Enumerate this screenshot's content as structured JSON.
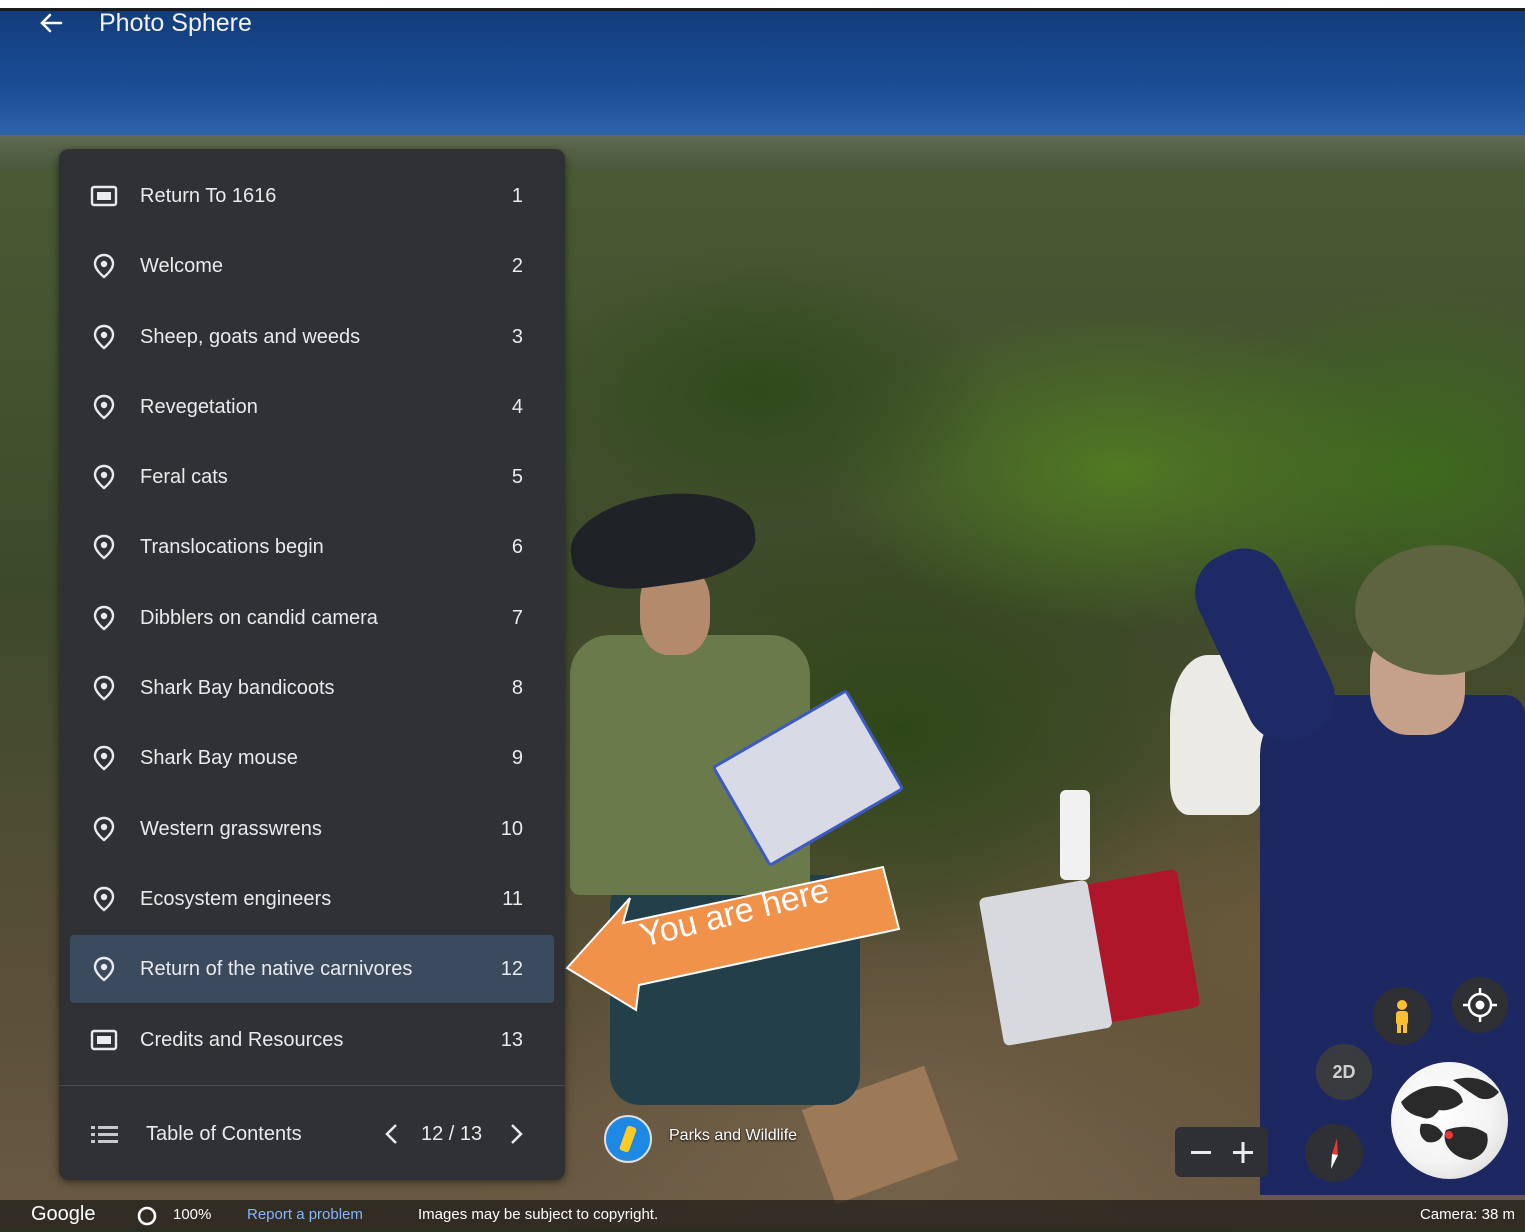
{
  "header": {
    "title": "Photo Sphere",
    "back_icon": "arrow-left-icon"
  },
  "tour": {
    "items": [
      {
        "icon": "slide-icon",
        "label": "Return To 1616",
        "number": "1",
        "active": false
      },
      {
        "icon": "place-icon",
        "label": "Welcome",
        "number": "2",
        "active": false
      },
      {
        "icon": "place-icon",
        "label": "Sheep, goats and weeds",
        "number": "3",
        "active": false
      },
      {
        "icon": "place-icon",
        "label": "Revegetation",
        "number": "4",
        "active": false
      },
      {
        "icon": "place-icon",
        "label": "Feral cats",
        "number": "5",
        "active": false
      },
      {
        "icon": "place-icon",
        "label": "Translocations begin",
        "number": "6",
        "active": false
      },
      {
        "icon": "place-icon",
        "label": "Dibblers on candid camera",
        "number": "7",
        "active": false
      },
      {
        "icon": "place-icon",
        "label": "Shark Bay bandicoots",
        "number": "8",
        "active": false
      },
      {
        "icon": "place-icon",
        "label": "Shark Bay mouse",
        "number": "9",
        "active": false
      },
      {
        "icon": "place-icon",
        "label": "Western grasswrens",
        "number": "10",
        "active": false
      },
      {
        "icon": "place-icon",
        "label": "Ecosystem engineers",
        "number": "11",
        "active": false
      },
      {
        "icon": "place-icon",
        "label": "Return of the native carnivores",
        "number": "12",
        "active": true
      },
      {
        "icon": "slide-icon",
        "label": "Credits and Resources",
        "number": "13",
        "active": false
      }
    ],
    "footer": {
      "label": "Table of Contents",
      "counter": "12 / 13"
    }
  },
  "callout": {
    "text": "You are here",
    "color": "#f0924a"
  },
  "attribution": {
    "label": "Parks and Wildlife"
  },
  "controls": {
    "btn_2d": "2D"
  },
  "bottom": {
    "brand": "Google",
    "percent": "100%",
    "report": "Report a problem",
    "copyright": "Images may be subject to copyright.",
    "camera": "Camera: 38 m"
  },
  "colors": {
    "panel": "#303134",
    "active_row": "#3c4a5e",
    "link": "#8ab4f8"
  }
}
